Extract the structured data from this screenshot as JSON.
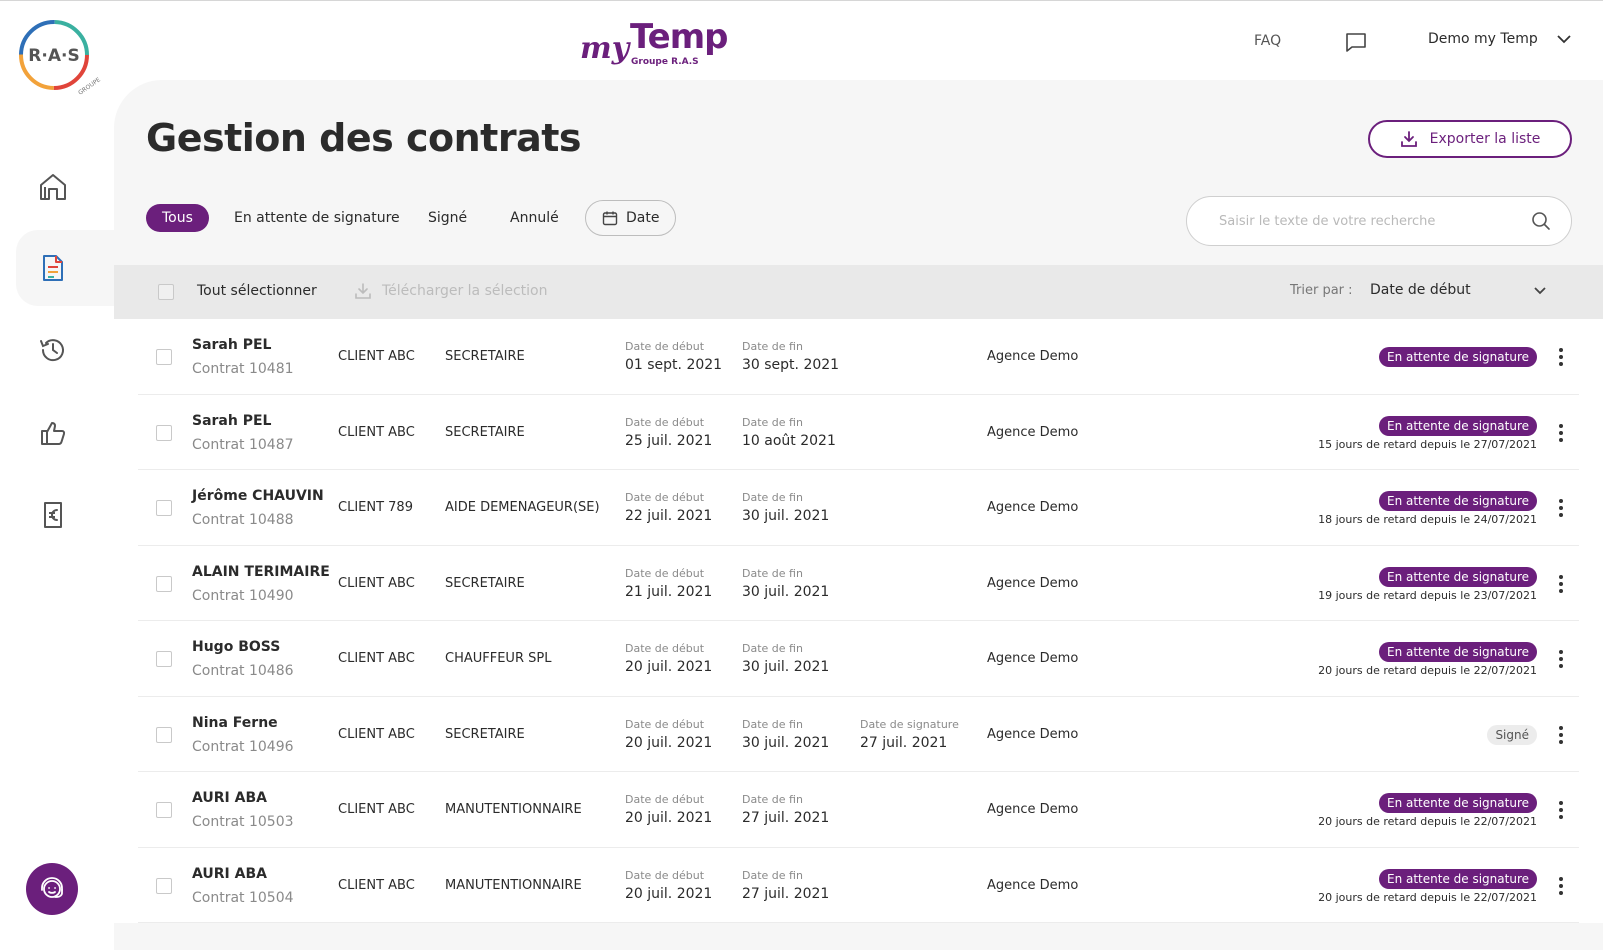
{
  "header": {
    "logo_text": "R·A·S",
    "logo_sub": "GROUPE",
    "brand_my": "my",
    "brand_temp": "Temp",
    "brand_groupe": "Groupe R.A.S",
    "faq": "FAQ",
    "user_name": "Demo my Temp"
  },
  "page": {
    "title": "Gestion des contrats",
    "export_label": "Exporter la liste"
  },
  "filters": {
    "all": "Tous",
    "pending": "En attente de signature",
    "signed": "Signé",
    "cancelled": "Annulé",
    "date": "Date"
  },
  "search": {
    "placeholder": "Saisir le texte de votre recherche"
  },
  "toolbar": {
    "select_all": "Tout sélectionner",
    "download_selection": "Télécharger la sélection",
    "sort_label": "Trier par :",
    "sort_value": "Date de début"
  },
  "labels": {
    "start": "Date de début",
    "end": "Date de fin",
    "signature": "Date de signature"
  },
  "rows": [
    {
      "name": "Sarah PEL",
      "contract": "Contrat 10481",
      "client": "CLIENT ABC",
      "job": "SECRETAIRE",
      "start": "01 sept. 2021",
      "end": "30 sept. 2021",
      "signature": "",
      "agency": "Agence Demo",
      "status": "En attente de signature",
      "status_type": "pending",
      "delay": ""
    },
    {
      "name": "Sarah PEL",
      "contract": "Contrat 10487",
      "client": "CLIENT ABC",
      "job": "SECRETAIRE",
      "start": "25 juil. 2021",
      "end": "10 août 2021",
      "signature": "",
      "agency": "Agence Demo",
      "status": "En attente de signature",
      "status_type": "pending",
      "delay": "15 jours de retard depuis le 27/07/2021"
    },
    {
      "name": "Jérôme CHAUVIN",
      "contract": "Contrat 10488",
      "client": "CLIENT 789",
      "job": "AIDE DEMENAGEUR(SE)",
      "start": "22 juil. 2021",
      "end": "30 juil. 2021",
      "signature": "",
      "agency": "Agence Demo",
      "status": "En attente de signature",
      "status_type": "pending",
      "delay": "18 jours de retard depuis le 24/07/2021"
    },
    {
      "name": "ALAIN TERIMAIRE",
      "contract": "Contrat 10490",
      "client": "CLIENT ABC",
      "job": "SECRETAIRE",
      "start": "21 juil. 2021",
      "end": "30 juil. 2021",
      "signature": "",
      "agency": "Agence Demo",
      "status": "En attente de signature",
      "status_type": "pending",
      "delay": "19 jours de retard depuis le 23/07/2021"
    },
    {
      "name": "Hugo BOSS",
      "contract": "Contrat 10486",
      "client": "CLIENT ABC",
      "job": "CHAUFFEUR SPL",
      "start": "20 juil. 2021",
      "end": "30 juil. 2021",
      "signature": "",
      "agency": "Agence Demo",
      "status": "En attente de signature",
      "status_type": "pending",
      "delay": "20 jours de retard depuis le 22/07/2021"
    },
    {
      "name": "Nina Ferne",
      "contract": "Contrat 10496",
      "client": "CLIENT ABC",
      "job": "SECRETAIRE",
      "start": "20 juil. 2021",
      "end": "30 juil. 2021",
      "signature": "27 juil. 2021",
      "agency": "Agence Demo",
      "status": "Signé",
      "status_type": "signed",
      "delay": ""
    },
    {
      "name": "AURI ABA",
      "contract": "Contrat 10503",
      "client": "CLIENT ABC",
      "job": "MANUTENTIONNAIRE",
      "start": "20 juil. 2021",
      "end": "27 juil. 2021",
      "signature": "",
      "agency": "Agence Demo",
      "status": "En attente de signature",
      "status_type": "pending",
      "delay": "20 jours de retard depuis le 22/07/2021"
    },
    {
      "name": "AURI ABA",
      "contract": "Contrat 10504",
      "client": "CLIENT ABC",
      "job": "MANUTENTIONNAIRE",
      "start": "20 juil. 2021",
      "end": "27 juil. 2021",
      "signature": "",
      "agency": "Agence Demo",
      "status": "En attente de signature",
      "status_type": "pending",
      "delay": "20 jours de retard depuis le 22/07/2021"
    }
  ],
  "icons": {
    "home": "home-icon",
    "contracts": "document-icon",
    "history": "clock-history-icon",
    "feedback": "thumbs-up-icon",
    "payments": "euro-document-icon",
    "help": "support-agent-icon"
  },
  "colors": {
    "brand": "#6b1f7c"
  }
}
